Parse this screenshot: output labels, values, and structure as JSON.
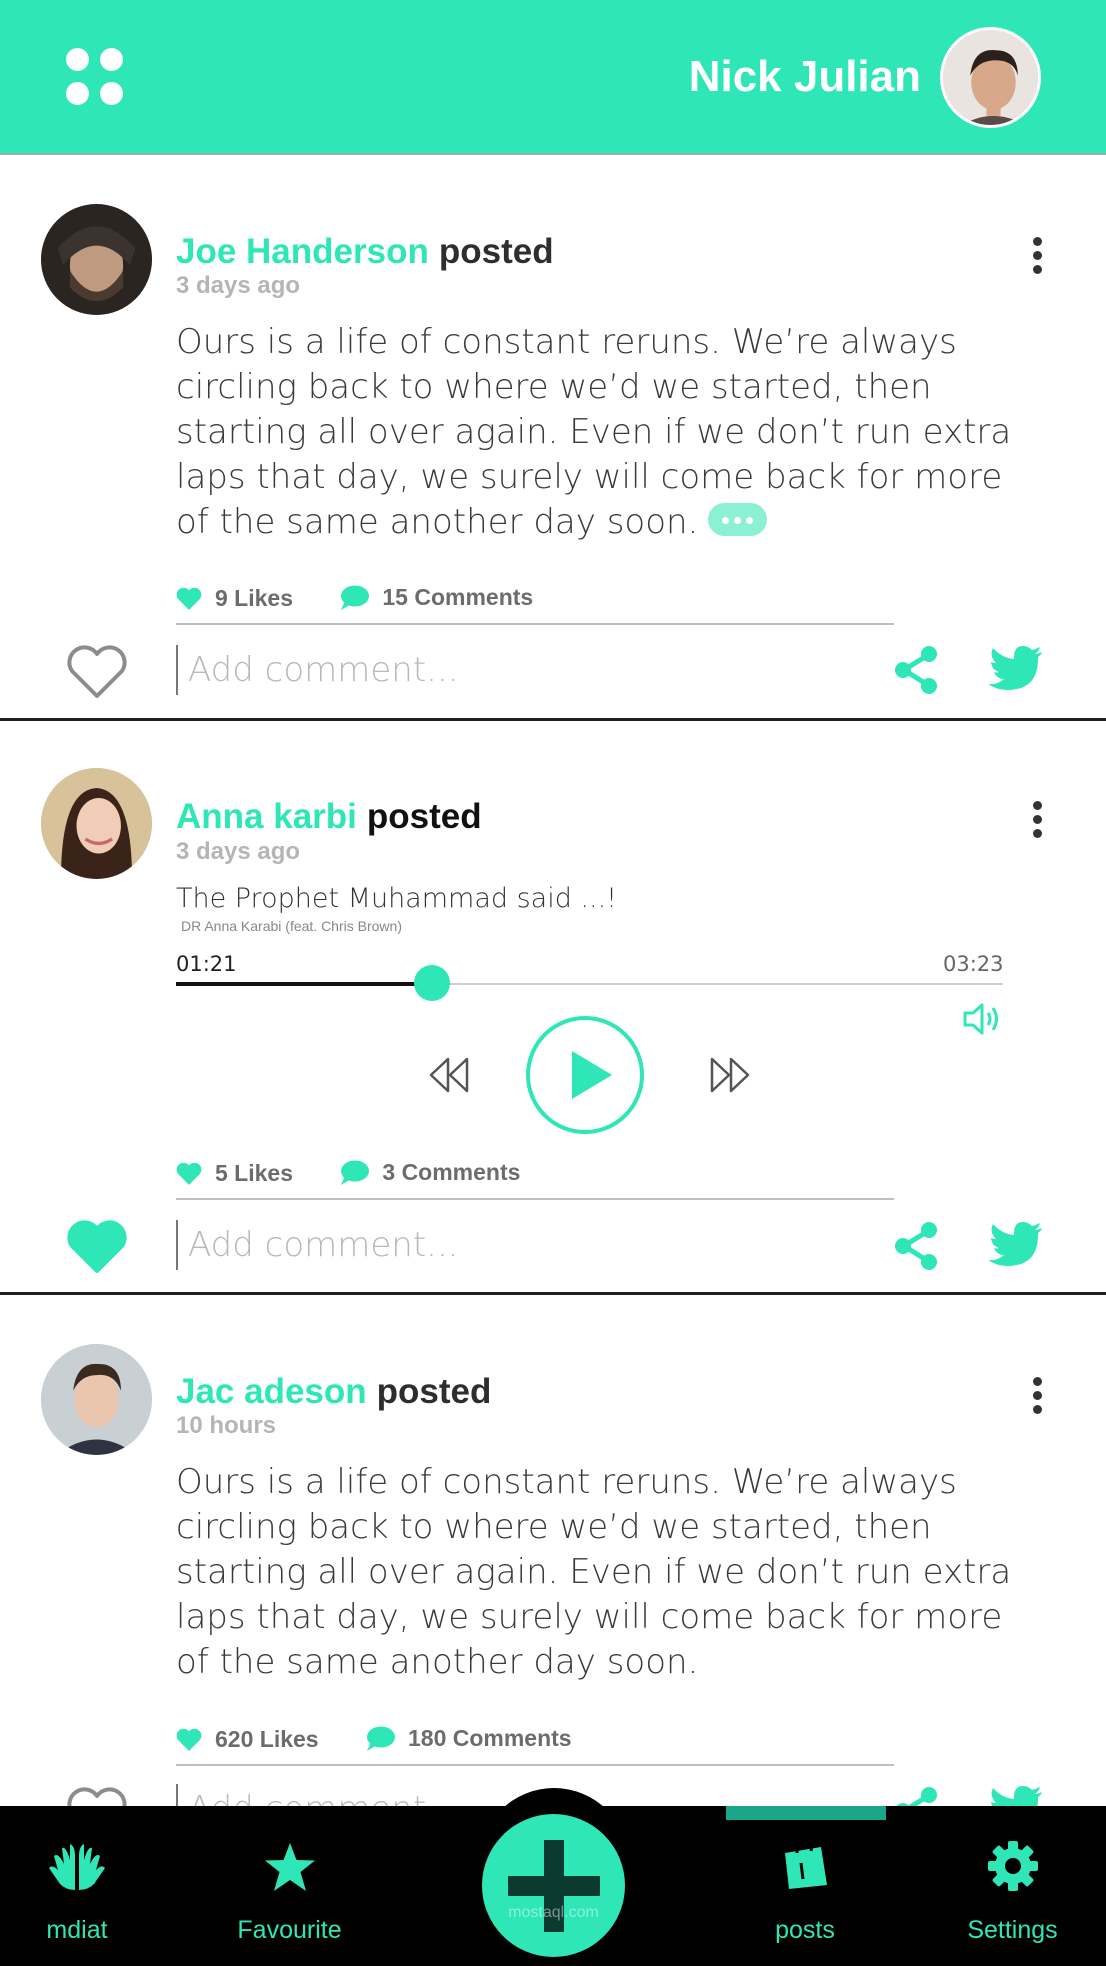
{
  "header": {
    "user_name": "Nick Julian"
  },
  "posts": [
    {
      "author": "Joe Handerson",
      "verb": "posted",
      "time": "3 days ago",
      "text": "Ours is a life of constant reruns. We’re always circling back to where we’d we started, then starting all over again. Even if we don’t run extra laps that day, we surely will come back for more of the same another day soon.",
      "likes": "9 Likes",
      "comments": "15 Comments",
      "liked": false,
      "comment_placeholder": "Add comment..."
    },
    {
      "author": "Anna karbi",
      "verb": "posted",
      "time": "3 days ago",
      "likes": "5 Likes",
      "comments": "3 Comments",
      "liked": true,
      "comment_placeholder": "Add comment...",
      "audio": {
        "title": "The Prophet Muhammad said ...!",
        "subtitle": "DR Anna Karabi (feat. Chris Brown)",
        "current_time": "01:21",
        "total_time": "03:23",
        "progress": 0.31
      }
    },
    {
      "author": "Jac adeson",
      "verb": "posted",
      "time": "10 hours",
      "text": "Ours is a life of constant reruns. We’re always circling back to where we’d we started, then starting all over again. Even if we don’t run extra laps that day, we surely will come back for more of the same another day soon.",
      "likes": "620 Likes",
      "comments": "180 Comments",
      "liked": false,
      "comment_placeholder": "Add comment..."
    }
  ],
  "bottom_nav": {
    "items": [
      {
        "label": "mdiat",
        "icon": "praying-hands-icon"
      },
      {
        "label": "Favourite",
        "icon": "star-icon"
      },
      {
        "label": "posts",
        "icon": "shopping-bag-icon",
        "active": true
      },
      {
        "label": "Settings",
        "icon": "gear-icon"
      }
    ],
    "fab_icon": "plus-icon",
    "watermark": "mostaql.com"
  },
  "colors": {
    "accent": "#2ee6b6",
    "nav_background": "#000000",
    "active_indicator": "#1aa688"
  }
}
